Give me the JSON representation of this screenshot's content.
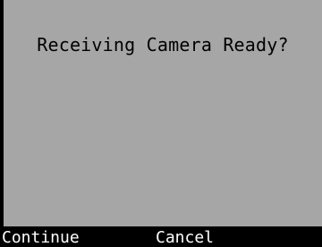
{
  "screen": {
    "message": "Receiving Camera Ready?"
  },
  "softkeys": {
    "left_label": "Continue",
    "middle_label": "Cancel"
  },
  "colors": {
    "content_background": "#a6a6a6",
    "softkey_bar": "#000000",
    "message_text": "#000000",
    "softkey_text": "#ffffff"
  }
}
